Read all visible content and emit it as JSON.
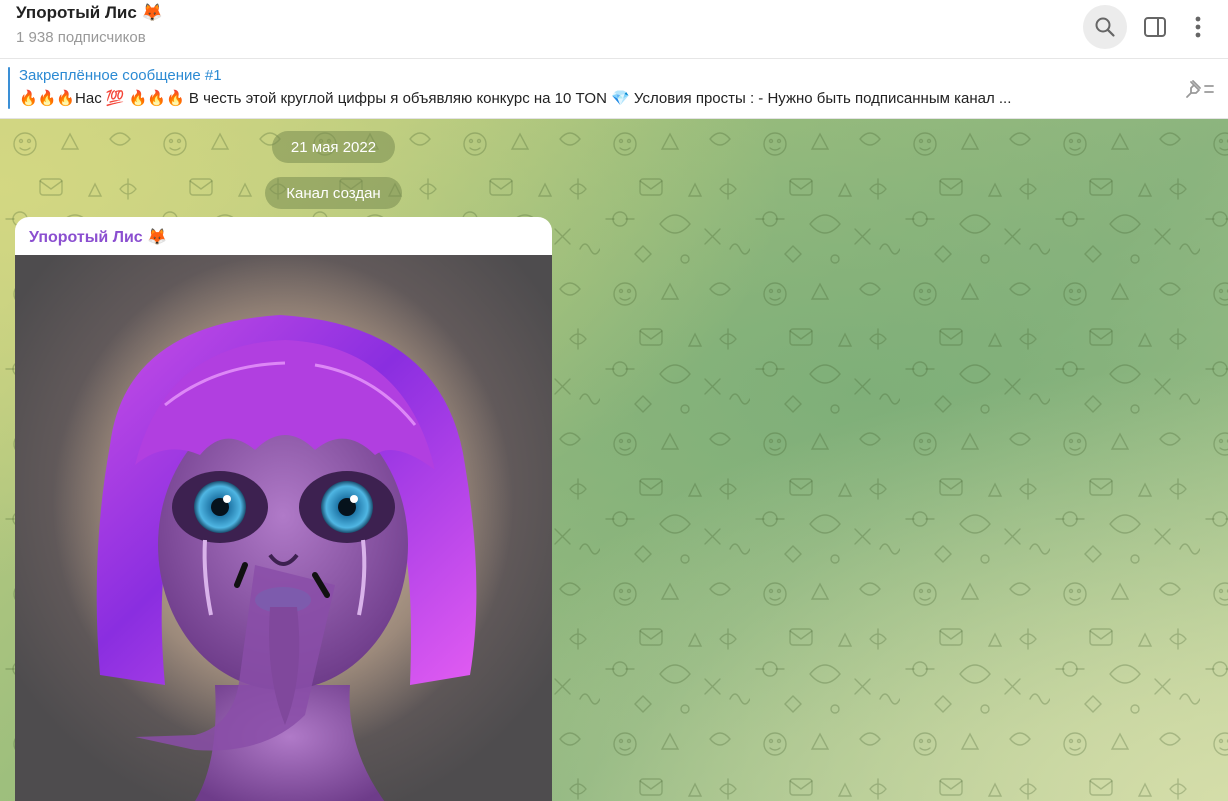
{
  "header": {
    "title": "Упоротый Лис 🦊",
    "subscribers": "1 938 подписчиков",
    "icons": [
      "search-icon",
      "sidebar-toggle-icon",
      "more-vertical-icon"
    ]
  },
  "pinned": {
    "title": "Закреплённое сообщение #1",
    "text": "🔥🔥🔥Нас 💯 🔥🔥🔥  В честь этой круглой цифры я объявляю конкурс на 10 TON 💎  Условия просты :  - Нужно быть подписанным канал ..."
  },
  "chat": {
    "date_label": "21 мая 2022",
    "service_message": "Канал создан",
    "message": {
      "author": "Упоротый Лис 🦊",
      "image_description": "purple-haired-creature-art"
    }
  },
  "colors": {
    "accent_blue": "#2b8ad3",
    "author_purple": "#8b4fd0",
    "pill_bg": "#8a9a5e"
  }
}
